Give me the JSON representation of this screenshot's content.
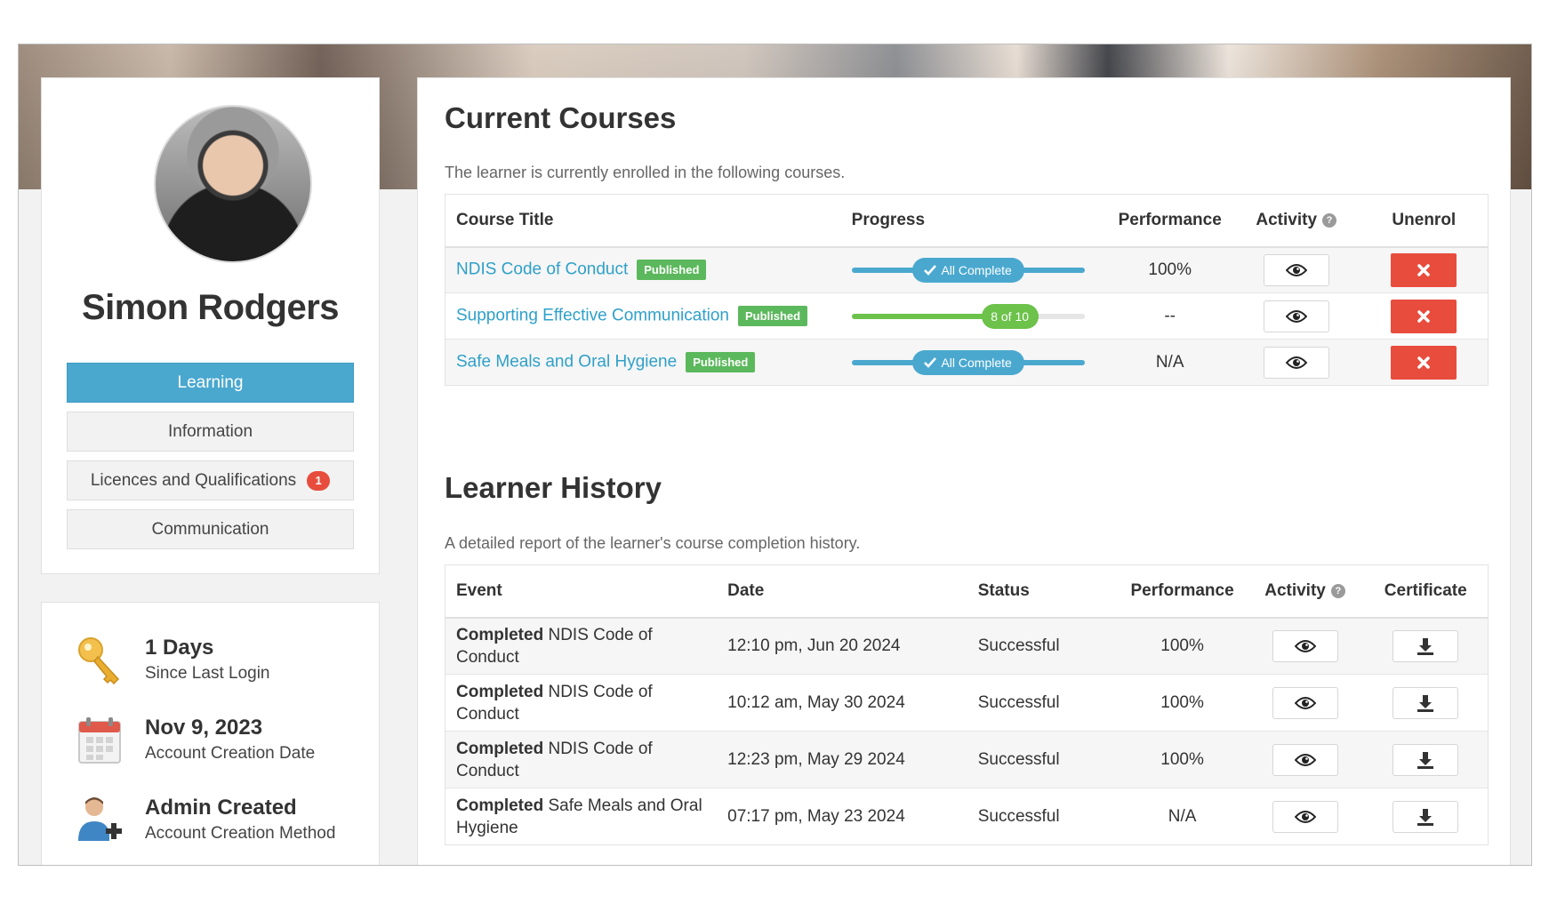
{
  "profile": {
    "name": "Simon Rodgers",
    "nav": [
      {
        "label": "Learning",
        "active": true
      },
      {
        "label": "Information",
        "active": false
      },
      {
        "label": "Licences and Qualifications",
        "active": false,
        "badge": "1"
      },
      {
        "label": "Communication",
        "active": false
      }
    ]
  },
  "stats": [
    {
      "value": "1 Days",
      "label": "Since Last Login",
      "icon": "key-icon"
    },
    {
      "value": "Nov 9, 2023",
      "label": "Account Creation Date",
      "icon": "calendar-icon"
    },
    {
      "value": "Admin Created",
      "label": "Account Creation Method",
      "icon": "add-user-icon"
    }
  ],
  "current_courses": {
    "title": "Current Courses",
    "description": "The learner is currently enrolled in the following courses.",
    "columns": [
      "Course Title",
      "Progress",
      "Performance",
      "Activity",
      "Unenrol"
    ],
    "rows": [
      {
        "title": "NDIS Code of Conduct",
        "tag": "Published",
        "progress_label": "All Complete",
        "progress_fraction": 1.0,
        "performance": "100%"
      },
      {
        "title": "Supporting Effective Communication",
        "tag": "Published",
        "progress_label": "8 of 10",
        "progress_fraction": 0.8,
        "performance": "--"
      },
      {
        "title": "Safe Meals and Oral Hygiene",
        "tag": "Published",
        "progress_label": "All Complete",
        "progress_fraction": 1.0,
        "performance": "N/A"
      }
    ]
  },
  "learner_history": {
    "title": "Learner History",
    "description": "A detailed report of the learner's course completion history.",
    "columns": [
      "Event",
      "Date",
      "Status",
      "Performance",
      "Activity",
      "Certificate"
    ],
    "rows": [
      {
        "event_bold": "Completed",
        "event_rest": "NDIS Code of Conduct",
        "date": "12:10 pm, Jun 20 2024",
        "status": "Successful",
        "performance": "100%"
      },
      {
        "event_bold": "Completed",
        "event_rest": "NDIS Code of Conduct",
        "date": "10:12 am, May 30 2024",
        "status": "Successful",
        "performance": "100%"
      },
      {
        "event_bold": "Completed",
        "event_rest": "NDIS Code of Conduct",
        "date": "12:23 pm, May 29 2024",
        "status": "Successful",
        "performance": "100%"
      },
      {
        "event_bold": "Completed",
        "event_rest": "Safe Meals and Oral Hygiene",
        "date": "07:17 pm, May 23 2024",
        "status": "Successful",
        "performance": "N/A"
      }
    ]
  },
  "colors": {
    "accent": "#4aa8cf",
    "link": "#2fa0c9",
    "success": "#5cb85c",
    "danger": "#e84c3d",
    "progress_complete": "#4aa8cf",
    "progress_partial": "#6cc24a"
  },
  "icons": {
    "help": "?",
    "view": "eye-icon",
    "delete": "close-icon",
    "download": "download-icon",
    "check": "check-icon"
  }
}
